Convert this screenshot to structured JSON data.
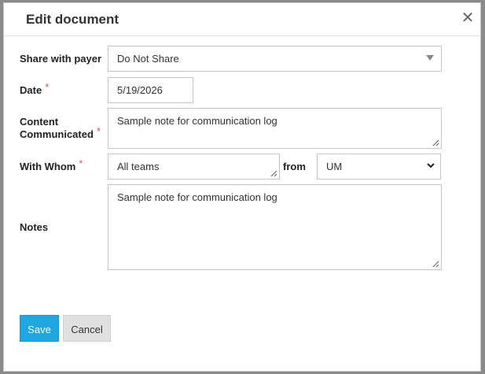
{
  "dialog": {
    "title": "Edit document",
    "close_glyph": "✕"
  },
  "form": {
    "share_with_payer": {
      "label": "Share with payer",
      "value": "Do Not Share"
    },
    "date": {
      "label": "Date",
      "required_mark": "*",
      "value": "5/19/2026"
    },
    "content_communicated": {
      "label_line1": "Content",
      "label_line2": "Communicated",
      "required_mark": "*",
      "value": "Sample note for communication log"
    },
    "with_whom": {
      "label": "With Whom",
      "required_mark": "*",
      "value": "All teams",
      "from_label": "from",
      "from_value": "UM"
    },
    "notes": {
      "label": "Notes",
      "value": "Sample note for communication log"
    }
  },
  "actions": {
    "save_label": "Save",
    "cancel_label": "Cancel"
  },
  "colors": {
    "primary_button": "#1ea7e1",
    "secondary_button": "#e0e0e0",
    "required": "#d9534f"
  },
  "icons": {
    "close": "close-icon",
    "dropdown": "caret-down-icon",
    "select": "chevron-down-icon",
    "resize": "resize-grip-icon"
  }
}
